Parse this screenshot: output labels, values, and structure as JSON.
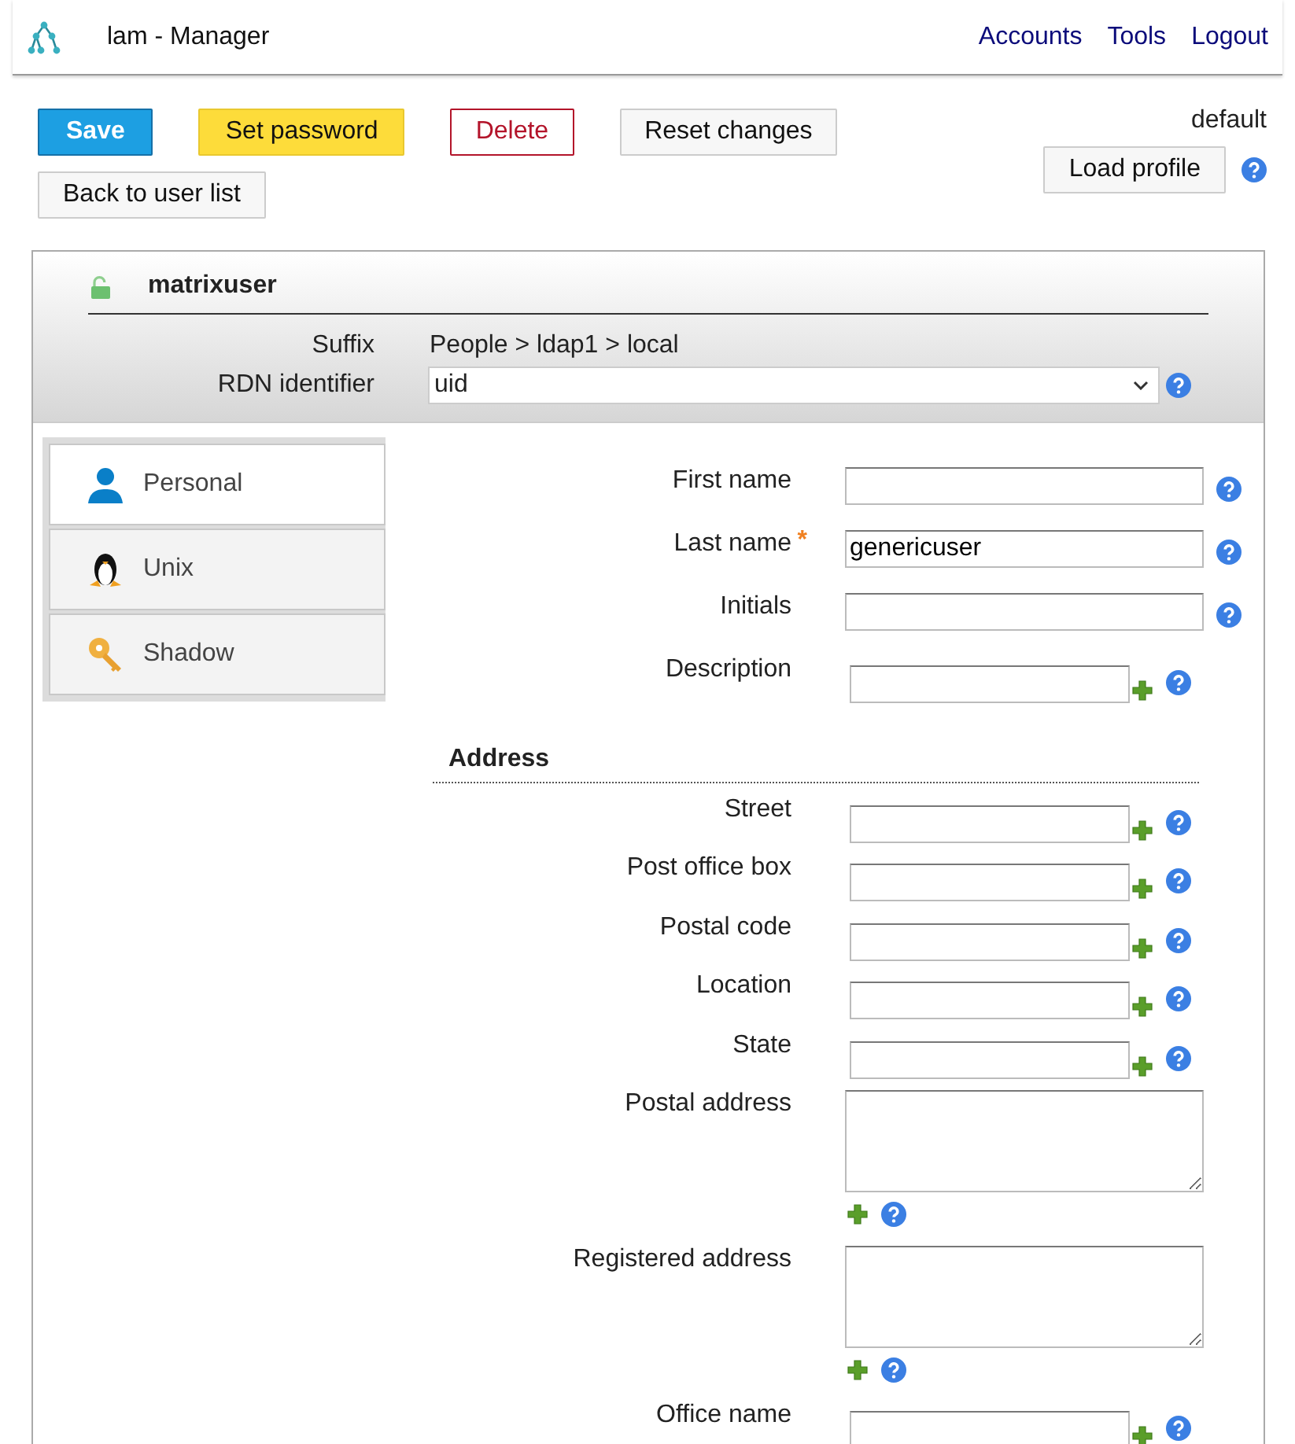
{
  "header": {
    "title": "lam - Manager",
    "nav": [
      "Accounts",
      "Tools",
      "Logout"
    ]
  },
  "toolbar": {
    "button_rows": [
      [
        {
          "label": "Save",
          "kind": "primary"
        },
        {
          "label": "Set password",
          "kind": "warning"
        },
        {
          "label": "Delete",
          "kind": "danger"
        },
        {
          "label": "Reset changes",
          "kind": "default"
        }
      ],
      [
        {
          "label": "Back to user list",
          "kind": "default"
        }
      ]
    ],
    "profile": {
      "name": "default",
      "button": "Load profile"
    }
  },
  "entry": {
    "name": "matrixuser",
    "suffix_label": "Suffix",
    "suffix": "People > ldap1 > local",
    "rdn_label": "RDN identifier",
    "rdn_value": "uid"
  },
  "tabs": [
    {
      "label": "Personal",
      "kind": "person",
      "selected": true
    },
    {
      "label": "Unix",
      "kind": "penguin",
      "selected": false
    },
    {
      "label": "Shadow",
      "kind": "key",
      "selected": false
    }
  ],
  "required_mark": "*",
  "sections": [
    {
      "fields": [
        {
          "label": "First name",
          "kind": "text",
          "required": false
        },
        {
          "label": "Last name",
          "kind": "text",
          "required": true,
          "value": "genericuser"
        },
        {
          "label": "Initials",
          "kind": "text",
          "required": false
        },
        {
          "label": "Description",
          "kind": "multi",
          "required": false
        }
      ]
    },
    {
      "heading": "Address",
      "fields": [
        {
          "label": "Street",
          "kind": "multi",
          "required": false
        },
        {
          "label": "Post office box",
          "kind": "multi",
          "required": false
        },
        {
          "label": "Postal code",
          "kind": "multi",
          "required": false
        },
        {
          "label": "Location",
          "kind": "multi",
          "required": false
        },
        {
          "label": "State",
          "kind": "multi",
          "required": false
        },
        {
          "label": "Postal address",
          "kind": "textarea",
          "required": false
        },
        {
          "label": "Registered address",
          "kind": "textarea",
          "required": false
        },
        {
          "label": "Office name",
          "kind": "multi",
          "required": false
        }
      ]
    }
  ]
}
